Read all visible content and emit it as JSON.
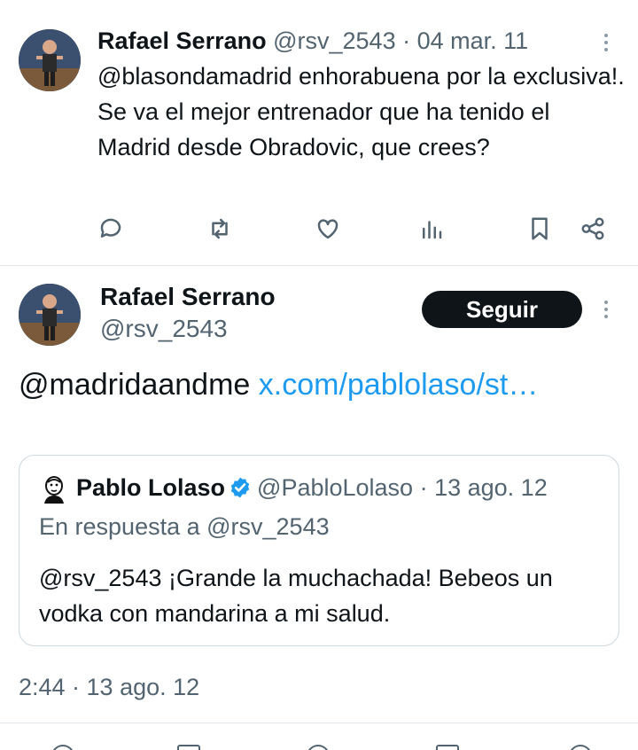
{
  "tweet1": {
    "author_name": "Rafael Serrano",
    "handle": "@rsv_2543",
    "separator": "·",
    "date": "04 mar. 11",
    "text": "@blasondamadrid enhorabuena por la exclusiva!. Se va el mejor entrenador que ha tenido el Madrid desde Obradovic, que crees?",
    "actions": [
      "reply-icon",
      "retweet-icon",
      "like-icon",
      "views-icon",
      "bookmark-icon",
      "share-icon"
    ]
  },
  "tweet2": {
    "author_name": "Rafael Serrano",
    "handle": "@rsv_2543",
    "follow_label": "Seguir",
    "text_mention": "@madridaandme",
    "text_link": "x.com/pablolaso/st…",
    "timestamp": "2:44 · 13 ago. 12"
  },
  "quote": {
    "author_name": "Pablo Lolaso",
    "handle": "@PabloLolaso",
    "separator": "·",
    "date": "13 ago. 12",
    "reply_to": "En respuesta a @rsv_2543",
    "text": "@rsv_2543 ¡Grande la muchachada! Bebeos un vodka con mandarina a mi salud."
  },
  "colors": {
    "link": "#1d9bf0",
    "muted": "#536471",
    "verified": "#1d9bf0",
    "button_bg": "#0f1419"
  }
}
